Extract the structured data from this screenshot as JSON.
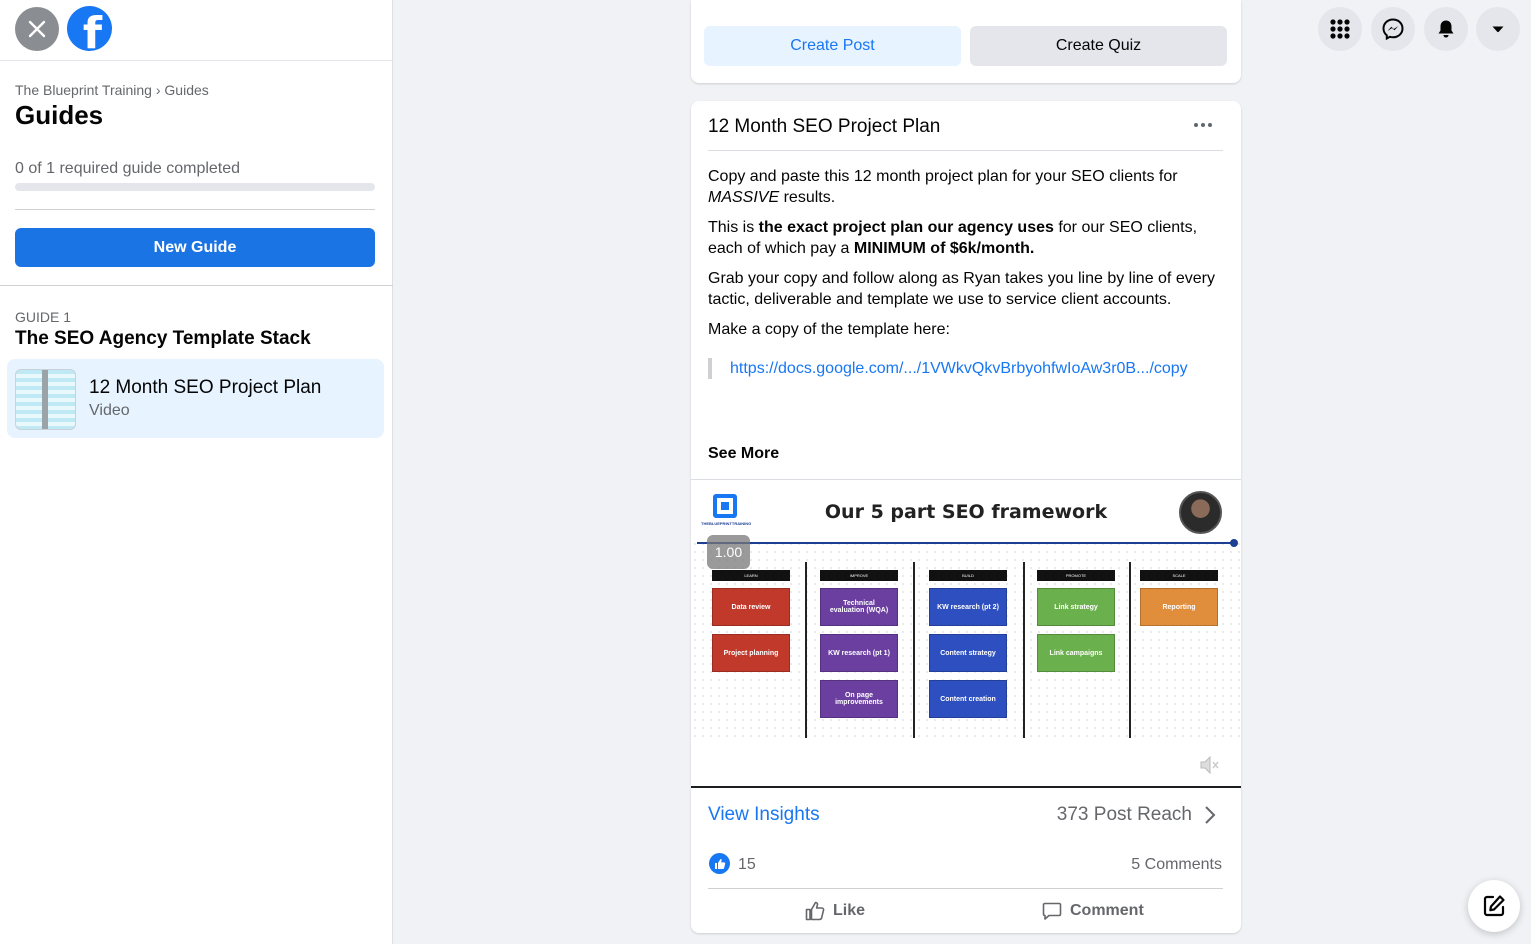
{
  "sidebar": {
    "breadcrumb": "The Blueprint Training › Guides",
    "title": "Guides",
    "progress_text": "0 of 1 required guide completed",
    "progress_fraction": 0,
    "new_guide_label": "New Guide",
    "guide_number": "GUIDE 1",
    "guide_title": "The SEO Agency Template Stack",
    "items": [
      {
        "title": "12 Month SEO Project Plan",
        "type": "Video"
      }
    ]
  },
  "icons": {
    "close": "close-icon",
    "logo": "facebook-logo-icon",
    "menu": "grid-menu-icon",
    "messenger": "messenger-icon",
    "notifications": "bell-icon",
    "account": "caret-down-icon",
    "compose": "compose-icon"
  },
  "create": {
    "post_label": "Create Post",
    "quiz_label": "Create Quiz"
  },
  "post": {
    "title": "12 Month SEO Project Plan",
    "p1_a": "Copy and paste this 12 month project plan for your SEO clients for ",
    "p1_em": "MASSIVE",
    "p1_b": " results.",
    "p2_a": "This is ",
    "p2_strong": "the exact project plan our agency uses",
    "p2_b": " for our SEO clients, each of which pay a ",
    "p2_strong2": "MINIMUM of $6k/month.",
    "p3": "Grab your copy and follow along as Ryan takes you line by line of every tactic, deliverable and template we use to service client accounts.",
    "p4": "Make a copy of the template here:",
    "link": "https://docs.google.com/.../1VWkvQkvBrbyohfwIoAw3r0B.../copy",
    "see_more": "See More",
    "video": {
      "title": "Our 5 part SEO framework",
      "brand": "THEBLUEPRINTTRAINING",
      "speed": "1.00",
      "columns": [
        {
          "head": "LEARN",
          "color": "#c0392b",
          "boxes": [
            "Data review",
            "Project planning"
          ]
        },
        {
          "head": "IMPROVE",
          "color": "#6a3fa0",
          "boxes": [
            "Technical evaluation (WQA)",
            "KW research (pt 1)",
            "On page improvements"
          ]
        },
        {
          "head": "BUILD",
          "color": "#2d4fbf",
          "boxes": [
            "KW research (pt 2)",
            "Content strategy",
            "Content creation"
          ]
        },
        {
          "head": "PROMOTE",
          "color": "#6ab04c",
          "boxes": [
            "Link strategy",
            "Link campaigns"
          ]
        },
        {
          "head": "SCALE",
          "color": "#e08e3c",
          "boxes": [
            "Reporting"
          ]
        }
      ]
    },
    "view_insights": "View Insights",
    "post_reach": "373 Post Reach",
    "likes": "15",
    "comments": "5 Comments",
    "like_label": "Like",
    "comment_label": "Comment"
  },
  "colors": {
    "accent": "#1877f2",
    "primary_button": "#1b74e4"
  }
}
